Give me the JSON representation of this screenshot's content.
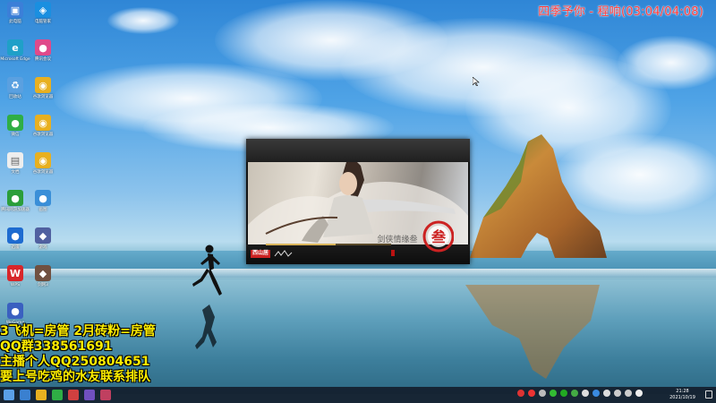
{
  "music": {
    "text": "四季予你 - 程响(03:04/04:08)"
  },
  "desktop_icons": [
    {
      "label": "此电脑",
      "icon": "computer-icon",
      "color": "#3b7fd8"
    },
    {
      "label": "电脑管家",
      "icon": "shield-icon",
      "color": "#1a8fe0"
    },
    {
      "label": "Microsoft Edge",
      "icon": "edge-icon",
      "color": "#1fa0c8"
    },
    {
      "label": "腾讯会议",
      "icon": "app-icon",
      "color": "#e04a8a"
    },
    {
      "label": "回收站",
      "icon": "recycle-bin-icon",
      "color": "#5aa0e0"
    },
    {
      "label": "谷歌浏览器",
      "icon": "chrome-icon",
      "color": "#e8b020"
    },
    {
      "label": "微信",
      "icon": "app-icon",
      "color": "#2fae45"
    },
    {
      "label": "谷歌浏览器",
      "icon": "chrome-icon",
      "color": "#e8b020"
    },
    {
      "label": "文档",
      "icon": "file-icon",
      "color": "#eeeeee"
    },
    {
      "label": "谷歌浏览器",
      "icon": "chrome-icon",
      "color": "#e8b020"
    },
    {
      "label": "腾讯网游加速器",
      "icon": "app-icon",
      "color": "#2b9e3a"
    },
    {
      "label": "画图",
      "icon": "app-icon",
      "color": "#3a8fd8"
    },
    {
      "label": "迅雷",
      "icon": "app-icon",
      "color": "#1e6bd0"
    },
    {
      "label": "游戏",
      "icon": "game-icon",
      "color": "#5060a0"
    },
    {
      "label": "WPS",
      "icon": "wps-icon",
      "color": "#d8262a"
    },
    {
      "label": "剑网3",
      "icon": "game-icon",
      "color": "#705040"
    },
    {
      "label": "WeGame",
      "icon": "app-icon",
      "color": "#3a60c0"
    }
  ],
  "launcher": {
    "publisher_badge": "西山居",
    "logo_text": "剑侠情缘叁",
    "logo_mark": "叁",
    "progress": 0.56
  },
  "overlay_lines": [
    "3飞机=房管 2月砖粉=房管",
    "QQ群338561691",
    "主播个人QQ250804651",
    "要上号吃鸡的水友联系排队"
  ],
  "taskbar": {
    "time": "21:28",
    "date": "2021/10/19"
  },
  "colors": {
    "overlay_text": "#ffee00",
    "music_text": "#ff3b3b"
  }
}
